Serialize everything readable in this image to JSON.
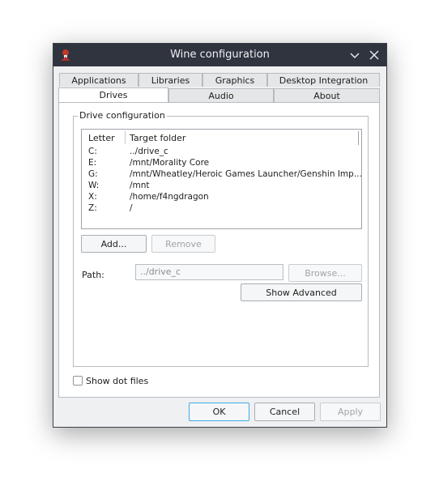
{
  "window": {
    "title": "Wine configuration"
  },
  "tabs": {
    "row1": [
      "Applications",
      "Libraries",
      "Graphics",
      "Desktop Integration"
    ],
    "row2": [
      "Drives",
      "Audio",
      "About"
    ],
    "active": "Drives"
  },
  "drive_config": {
    "group_title": "Drive configuration",
    "columns": {
      "letter": "Letter",
      "target": "Target folder"
    },
    "rows": [
      {
        "letter": "C:",
        "target": "../drive_c"
      },
      {
        "letter": "E:",
        "target": "/mnt/Morality Core"
      },
      {
        "letter": "G:",
        "target": "/mnt/Wheatley/Heroic Games Launcher/Genshin Imp..."
      },
      {
        "letter": "W:",
        "target": "/mnt"
      },
      {
        "letter": "X:",
        "target": "/home/f4ngdragon"
      },
      {
        "letter": "Z:",
        "target": "/"
      }
    ],
    "add_label": "Add...",
    "remove_label": "Remove",
    "path_label": "Path:",
    "path_value": "../drive_c",
    "browse_label": "Browse...",
    "show_advanced_label": "Show Advanced"
  },
  "show_dot_files_label": "Show dot files",
  "footer": {
    "ok": "OK",
    "cancel": "Cancel",
    "apply": "Apply"
  },
  "colors": {
    "titlebar": "#2f343f",
    "window_bg": "#eff0f1",
    "focus_accent": "#3daee9"
  }
}
